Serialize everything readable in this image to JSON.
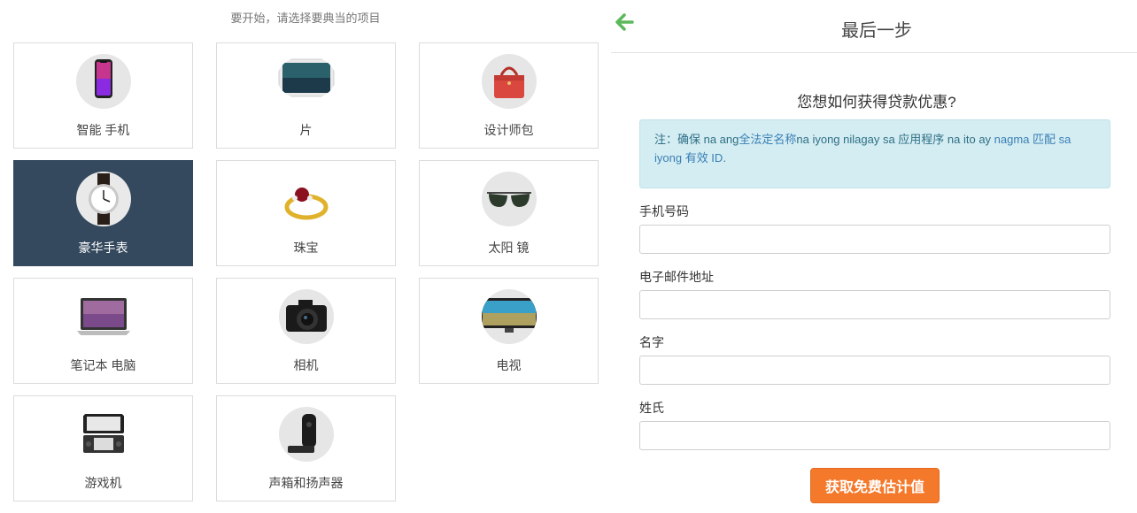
{
  "left": {
    "subtitle": "要开始，请选择要典当的项目",
    "categories": [
      {
        "label": "智能 手机",
        "icon": "smartphone-icon"
      },
      {
        "label": "片",
        "icon": "tablet-icon"
      },
      {
        "label": "设计师包",
        "icon": "designer-bag-icon"
      },
      {
        "label": "豪华手表",
        "icon": "luxury-watch-icon",
        "selected": true
      },
      {
        "label": "珠宝",
        "icon": "jewelry-ring-icon"
      },
      {
        "label": "太阳 镜",
        "icon": "sunglasses-icon"
      },
      {
        "label": "笔记本 电脑",
        "icon": "laptop-icon"
      },
      {
        "label": "相机",
        "icon": "camera-icon"
      },
      {
        "label": "电视",
        "icon": "tv-icon"
      },
      {
        "label": "游戏机",
        "icon": "game-console-icon"
      },
      {
        "label": "声箱和扬声器",
        "icon": "speaker-icon"
      }
    ]
  },
  "right": {
    "title": "最后一步",
    "question": "您想如何获得贷款优惠?",
    "notice": {
      "part1": "注：确保 na ang",
      "link1": "全法定名称",
      "part2": "na iyong nilagay sa 应用程序 na ito ay ",
      "link2": "nagma 匹配 sa iyong 有效 ID",
      "part3": "."
    },
    "fields": {
      "phone_label": "手机号码",
      "phone_value": "",
      "email_label": "电子邮件地址",
      "email_value": "",
      "first_name_label": "名字",
      "first_name_value": "",
      "last_name_label": "姓氏",
      "last_name_value": ""
    },
    "submit_label": "获取免费估计值"
  },
  "colors": {
    "selected_card": "#34495e",
    "accent_orange": "#f5792a",
    "back_arrow_green": "#5cb85c",
    "notice_bg": "#d4edf2"
  }
}
